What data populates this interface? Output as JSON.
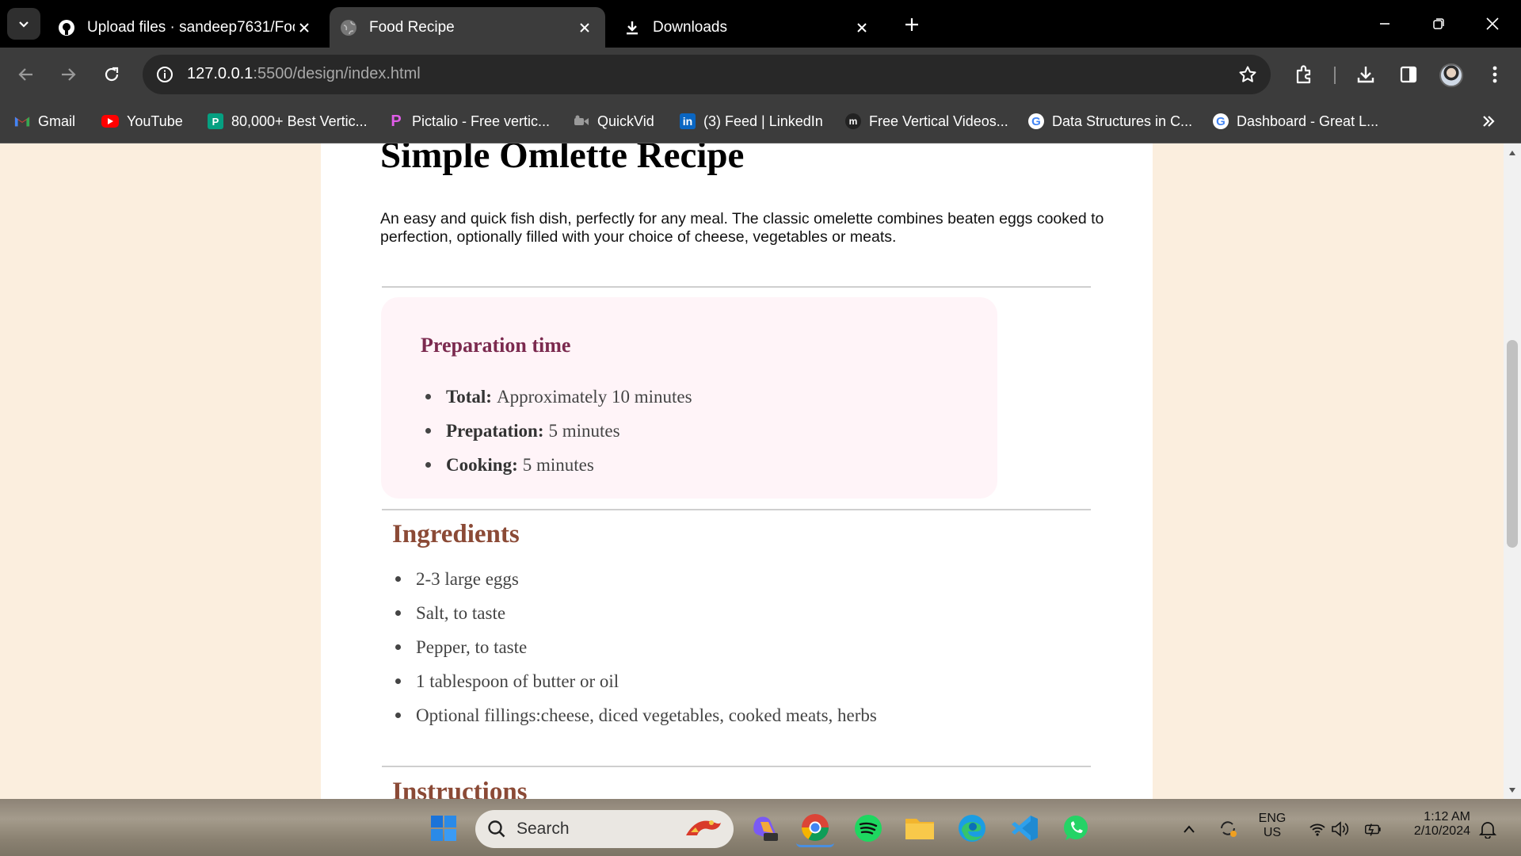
{
  "browser": {
    "tabs": [
      {
        "label": "Upload files · sandeep7631/Foo",
        "icon": "github-icon",
        "active": false
      },
      {
        "label": "Food Recipe",
        "icon": "globe-icon",
        "active": true
      },
      {
        "label": "Downloads",
        "icon": "download-icon",
        "active": false
      }
    ],
    "url_host": "127.0.0.1",
    "url_path": ":5500/design/index.html",
    "bookmarks": [
      {
        "label": "Gmail",
        "icon": "gmail-icon",
        "color": "#ea4335"
      },
      {
        "label": "YouTube",
        "icon": "youtube-icon",
        "color": "#ff0000"
      },
      {
        "label": "80,000+ Best Vertic...",
        "icon": "pexels-icon",
        "color": "#05a081"
      },
      {
        "label": "Pictalio - Free vertic...",
        "icon": "pictalio-icon",
        "color": "#c04ad9"
      },
      {
        "label": "QuickVid",
        "icon": "quickvid-icon",
        "color": "#9a9a9a"
      },
      {
        "label": "(3) Feed | LinkedIn",
        "icon": "linkedin-icon",
        "color": "#0a66c2"
      },
      {
        "label": "Free Vertical Videos...",
        "icon": "mixkit-icon",
        "color": "#222222"
      },
      {
        "label": "Data Structures in C...",
        "icon": "google-icon",
        "color": "#4285f4"
      },
      {
        "label": "Dashboard - Great L...",
        "icon": "google-icon",
        "color": "#4285f4"
      }
    ]
  },
  "page": {
    "title": "Simple Omlette Recipe",
    "description": "An easy and quick fish dish, perfectly for any meal. The classic omelette combines beaten eggs cooked to perfection, optionally filled with your choice of cheese, vegetables or meats.",
    "prep": {
      "heading": "Preparation time",
      "items": [
        {
          "label": "Total:",
          "value": "Approximately 10 minutes"
        },
        {
          "label": "Prepatation:",
          "value": "5 minutes"
        },
        {
          "label": "Cooking:",
          "value": "5 minutes"
        }
      ]
    },
    "ingredients": {
      "heading": "Ingredients",
      "items": [
        "2-3 large eggs",
        "Salt, to taste",
        "Pepper, to taste",
        "1 tablespoon of butter or oil",
        "Optional fillings:cheese, diced vegetables, cooked meats, herbs"
      ]
    },
    "instructions": {
      "heading": "Instructions"
    },
    "colors": {
      "background": "#fbeede",
      "prep_bg": "#fff4f8",
      "prep_heading": "#7b2a4f",
      "section_heading": "#8b4a36"
    }
  },
  "taskbar": {
    "search_label": "Search",
    "lang_top": "ENG",
    "lang_bottom": "US",
    "time": "1:12 AM",
    "date": "2/10/2024"
  }
}
